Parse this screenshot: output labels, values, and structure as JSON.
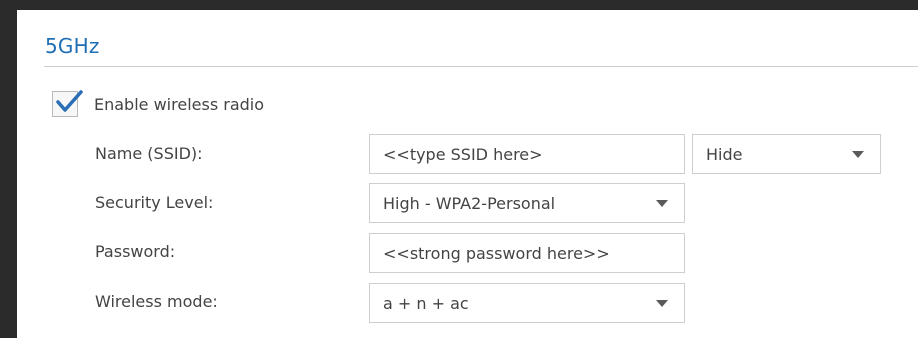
{
  "section": {
    "title": "5GHz"
  },
  "radio": {
    "enabled": true,
    "label": "Enable wireless radio"
  },
  "form": {
    "ssid": {
      "label": "Name (SSID):",
      "value": "<<type SSID here>",
      "visibility": "Hide"
    },
    "security": {
      "label": "Security Level:",
      "value": "High - WPA2-Personal"
    },
    "password": {
      "label": "Password:",
      "value": "<<strong password here>>"
    },
    "mode": {
      "label": "Wireless mode:",
      "value": "a + n + ac"
    }
  },
  "colors": {
    "title": "#1f6fb5",
    "check": "#2a6db5",
    "text": "#444444",
    "border": "#cfcfcf",
    "frame": "#2b2b2b"
  },
  "icons": {
    "check": "checkmark-icon",
    "dropdown": "triangle-down-icon"
  }
}
